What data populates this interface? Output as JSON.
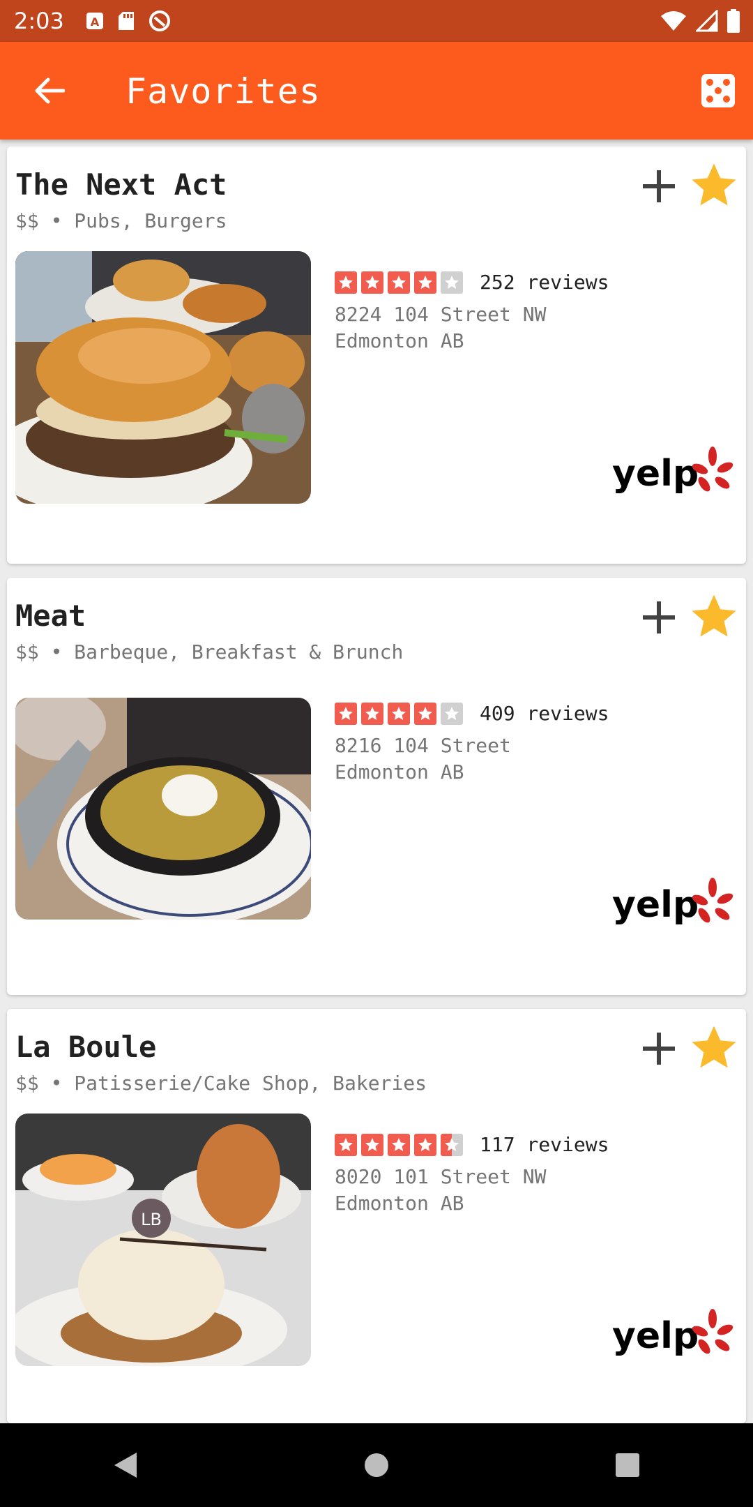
{
  "status_bar": {
    "time": "2:03"
  },
  "app_bar": {
    "title": "Favorites"
  },
  "colors": {
    "accent": "#fd5a1e",
    "status_bar": "#c0441c",
    "star_favorite": "#fbb92c",
    "yelp_star": "#f15c4f",
    "yelp_red": "#d32323"
  },
  "restaurants": [
    {
      "name": "The Next Act",
      "subtitle": "$$ • Pubs, Burgers",
      "rating": 4,
      "reviews": "252 reviews",
      "address_line1": "8224 104 Street NW",
      "address_line2": "Edmonton AB",
      "photo": "burger-photo"
    },
    {
      "name": "Meat",
      "subtitle": "$$ • Barbeque, Breakfast & Brunch",
      "rating": 4,
      "reviews": "409 reviews",
      "address_line1": "8216 104 Street",
      "address_line2": "Edmonton AB",
      "photo": "skillet-photo"
    },
    {
      "name": "La Boule",
      "subtitle": "$$ • Patisserie/Cake Shop, Bakeries",
      "rating": 4.5,
      "reviews": "117 reviews",
      "address_line1": "8020 101 Street NW",
      "address_line2": "Edmonton AB",
      "photo": "pastry-photo"
    }
  ],
  "yelp_logo_text": "yelp"
}
